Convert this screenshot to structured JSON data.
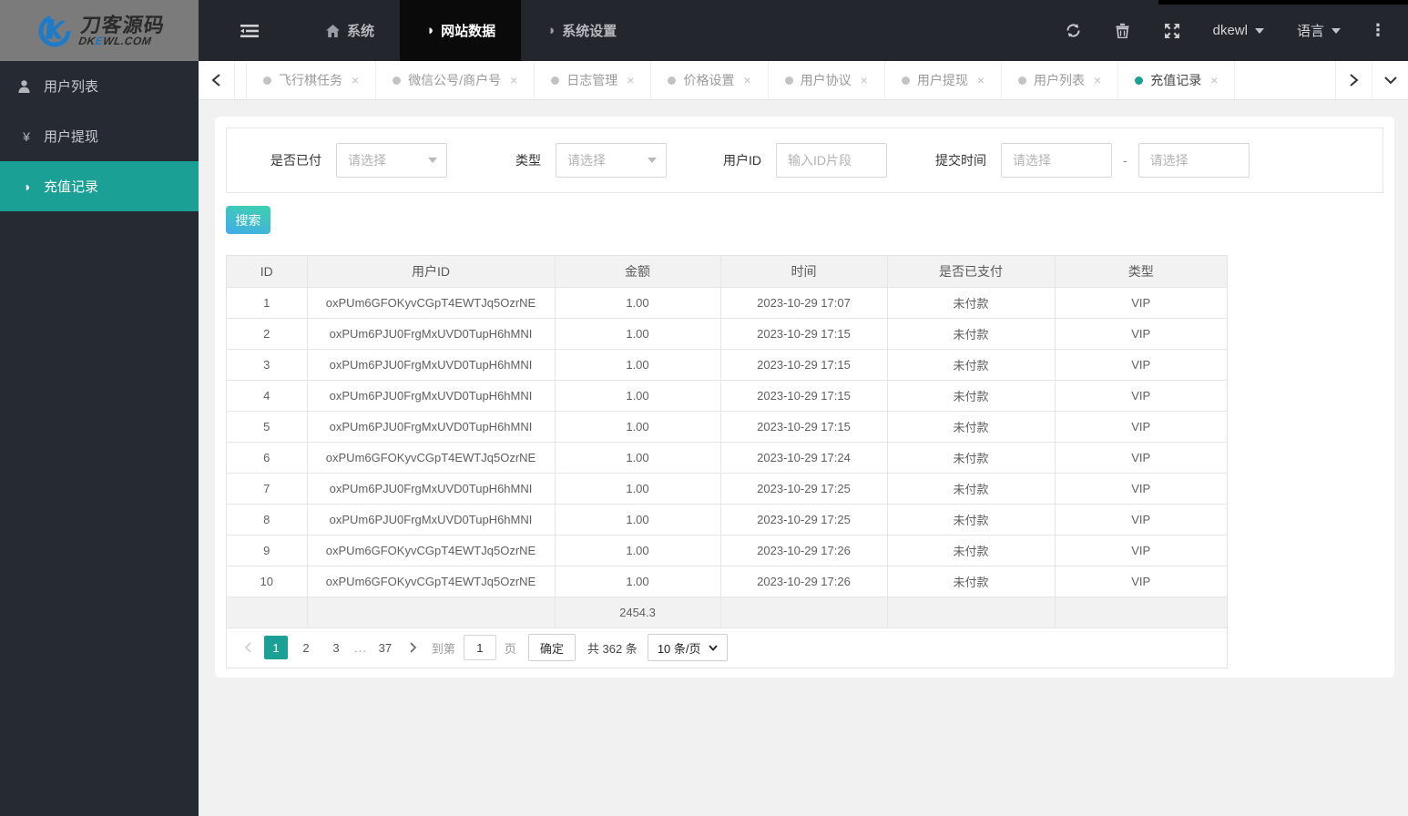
{
  "colors": {
    "accent": "#1aa094",
    "topbar": "#23262d",
    "sidebar": "#262a33",
    "nav_active": "#0a0a0a",
    "search_gradient_start": "#3ed2ab",
    "search_gradient_end": "#41abe9"
  },
  "logo": {
    "title": "刀客源码",
    "sub_prefix": "DK",
    "sub_accent": "E",
    "sub_suffix": "WL.COM"
  },
  "navbar": {
    "menu": [
      {
        "label": "系统"
      },
      {
        "label": "网站数据"
      },
      {
        "label": "系统设置"
      }
    ],
    "username": "dkewl",
    "language_label": "语言"
  },
  "tabbar": {
    "tabs": [
      {
        "label": "飞行棋任务"
      },
      {
        "label": "微信公号/商户号"
      },
      {
        "label": "日志管理"
      },
      {
        "label": "价格设置"
      },
      {
        "label": "用户协议"
      },
      {
        "label": "用户提现"
      },
      {
        "label": "用户列表"
      },
      {
        "label": "充值记录"
      }
    ],
    "close_glyph": "×"
  },
  "sidebar": {
    "items": [
      {
        "label": "用户列表",
        "icon": "user-icon"
      },
      {
        "label": "用户提现",
        "icon": "yen-icon",
        "glyph": "¥"
      },
      {
        "label": "充值记录",
        "icon": "adjust-icon",
        "glyph": "◑"
      }
    ]
  },
  "filters": {
    "paid": {
      "label": "是否已付",
      "placeholder": "请选择"
    },
    "type": {
      "label": "类型",
      "placeholder": "请选择"
    },
    "user_id": {
      "label": "用户ID",
      "placeholder": "输入ID片段"
    },
    "submit_time": {
      "label": "提交时间",
      "placeholder_start": "请选择",
      "placeholder_end": "请选择",
      "separator": "-"
    },
    "search_label": "搜索"
  },
  "table": {
    "columns": [
      "ID",
      "用户ID",
      "金额",
      "时间",
      "是否已支付",
      "类型"
    ],
    "rows": [
      [
        "1",
        "oxPUm6GFOKyvCGpT4EWTJq5OzrNE",
        "1.00",
        "2023-10-29 17:07",
        "未付款",
        "VIP"
      ],
      [
        "2",
        "oxPUm6PJU0FrgMxUVD0TupH6hMNI",
        "1.00",
        "2023-10-29 17:15",
        "未付款",
        "VIP"
      ],
      [
        "3",
        "oxPUm6PJU0FrgMxUVD0TupH6hMNI",
        "1.00",
        "2023-10-29 17:15",
        "未付款",
        "VIP"
      ],
      [
        "4",
        "oxPUm6PJU0FrgMxUVD0TupH6hMNI",
        "1.00",
        "2023-10-29 17:15",
        "未付款",
        "VIP"
      ],
      [
        "5",
        "oxPUm6PJU0FrgMxUVD0TupH6hMNI",
        "1.00",
        "2023-10-29 17:15",
        "未付款",
        "VIP"
      ],
      [
        "6",
        "oxPUm6GFOKyvCGpT4EWTJq5OzrNE",
        "1.00",
        "2023-10-29 17:24",
        "未付款",
        "VIP"
      ],
      [
        "7",
        "oxPUm6PJU0FrgMxUVD0TupH6hMNI",
        "1.00",
        "2023-10-29 17:25",
        "未付款",
        "VIP"
      ],
      [
        "8",
        "oxPUm6PJU0FrgMxUVD0TupH6hMNI",
        "1.00",
        "2023-10-29 17:25",
        "未付款",
        "VIP"
      ],
      [
        "9",
        "oxPUm6GFOKyvCGpT4EWTJq5OzrNE",
        "1.00",
        "2023-10-29 17:26",
        "未付款",
        "VIP"
      ],
      [
        "10",
        "oxPUm6GFOKyvCGpT4EWTJq5OzrNE",
        "1.00",
        "2023-10-29 17:26",
        "未付款",
        "VIP"
      ]
    ],
    "summary_amount": "2454.3"
  },
  "pagination": {
    "pages": [
      "1",
      "2",
      "3",
      "...",
      "37"
    ],
    "current": "1",
    "goto_label": "到第",
    "goto_value": "1",
    "page_unit_label": "页",
    "confirm_label": "确定",
    "total_label": "共 362 条",
    "page_size_label": "10 条/页"
  }
}
